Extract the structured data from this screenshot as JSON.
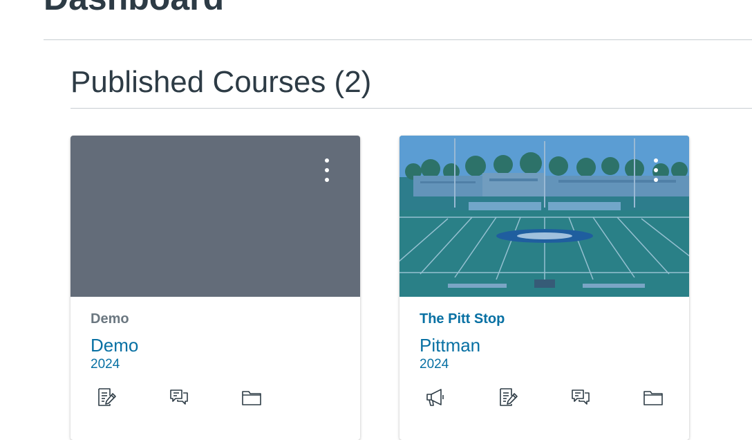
{
  "page": {
    "title": "Dashboard"
  },
  "section": {
    "title": "Published Courses (2)"
  },
  "courses": [
    {
      "short_name": "Demo",
      "name": "Demo",
      "term": "2024",
      "hero_color": "#636c79",
      "actions": [
        "assignments-icon",
        "discussions-icon",
        "files-icon"
      ]
    },
    {
      "short_name": "The Pitt Stop",
      "name": "Pittman",
      "term": "2024",
      "hero_color": "#3f8a80",
      "actions": [
        "announcements-icon",
        "assignments-icon",
        "discussions-icon",
        "files-icon"
      ]
    }
  ],
  "colors": {
    "link": "#0770a3",
    "heading": "#2d3b45",
    "muted": "#6b7780"
  }
}
